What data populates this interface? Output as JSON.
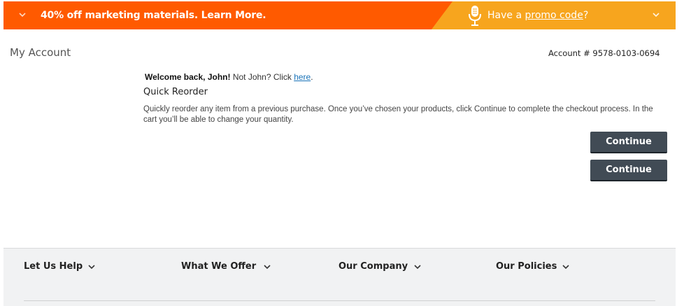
{
  "banner": {
    "offer_text": "40% off marketing materials. Learn More.",
    "promo_prefix": "Have a ",
    "promo_link": "promo code",
    "promo_suffix": "?",
    "colors": {
      "left": "#ff5a00",
      "right": "#f7a51e"
    }
  },
  "header": {
    "title": "My Account",
    "account_label": "Account # 9578-0103-0694"
  },
  "main": {
    "welcome_bold": "Welcome back, John!",
    "welcome_text": " Not John? Click ",
    "welcome_link": "here",
    "welcome_end": ".",
    "section_title": "Quick Reorder",
    "description": "Quickly reorder any item from a previous purchase. Once you’ve chosen your products, click Continue to complete the checkout process. In the cart you’ll be able to change your quantity.",
    "continue_label_1": "Continue",
    "continue_label_2": "Continue"
  },
  "footer": {
    "items": [
      {
        "label": "Let Us Help"
      },
      {
        "label": "What We Offer"
      },
      {
        "label": "Our Company"
      },
      {
        "label": "Our Policies"
      }
    ]
  }
}
